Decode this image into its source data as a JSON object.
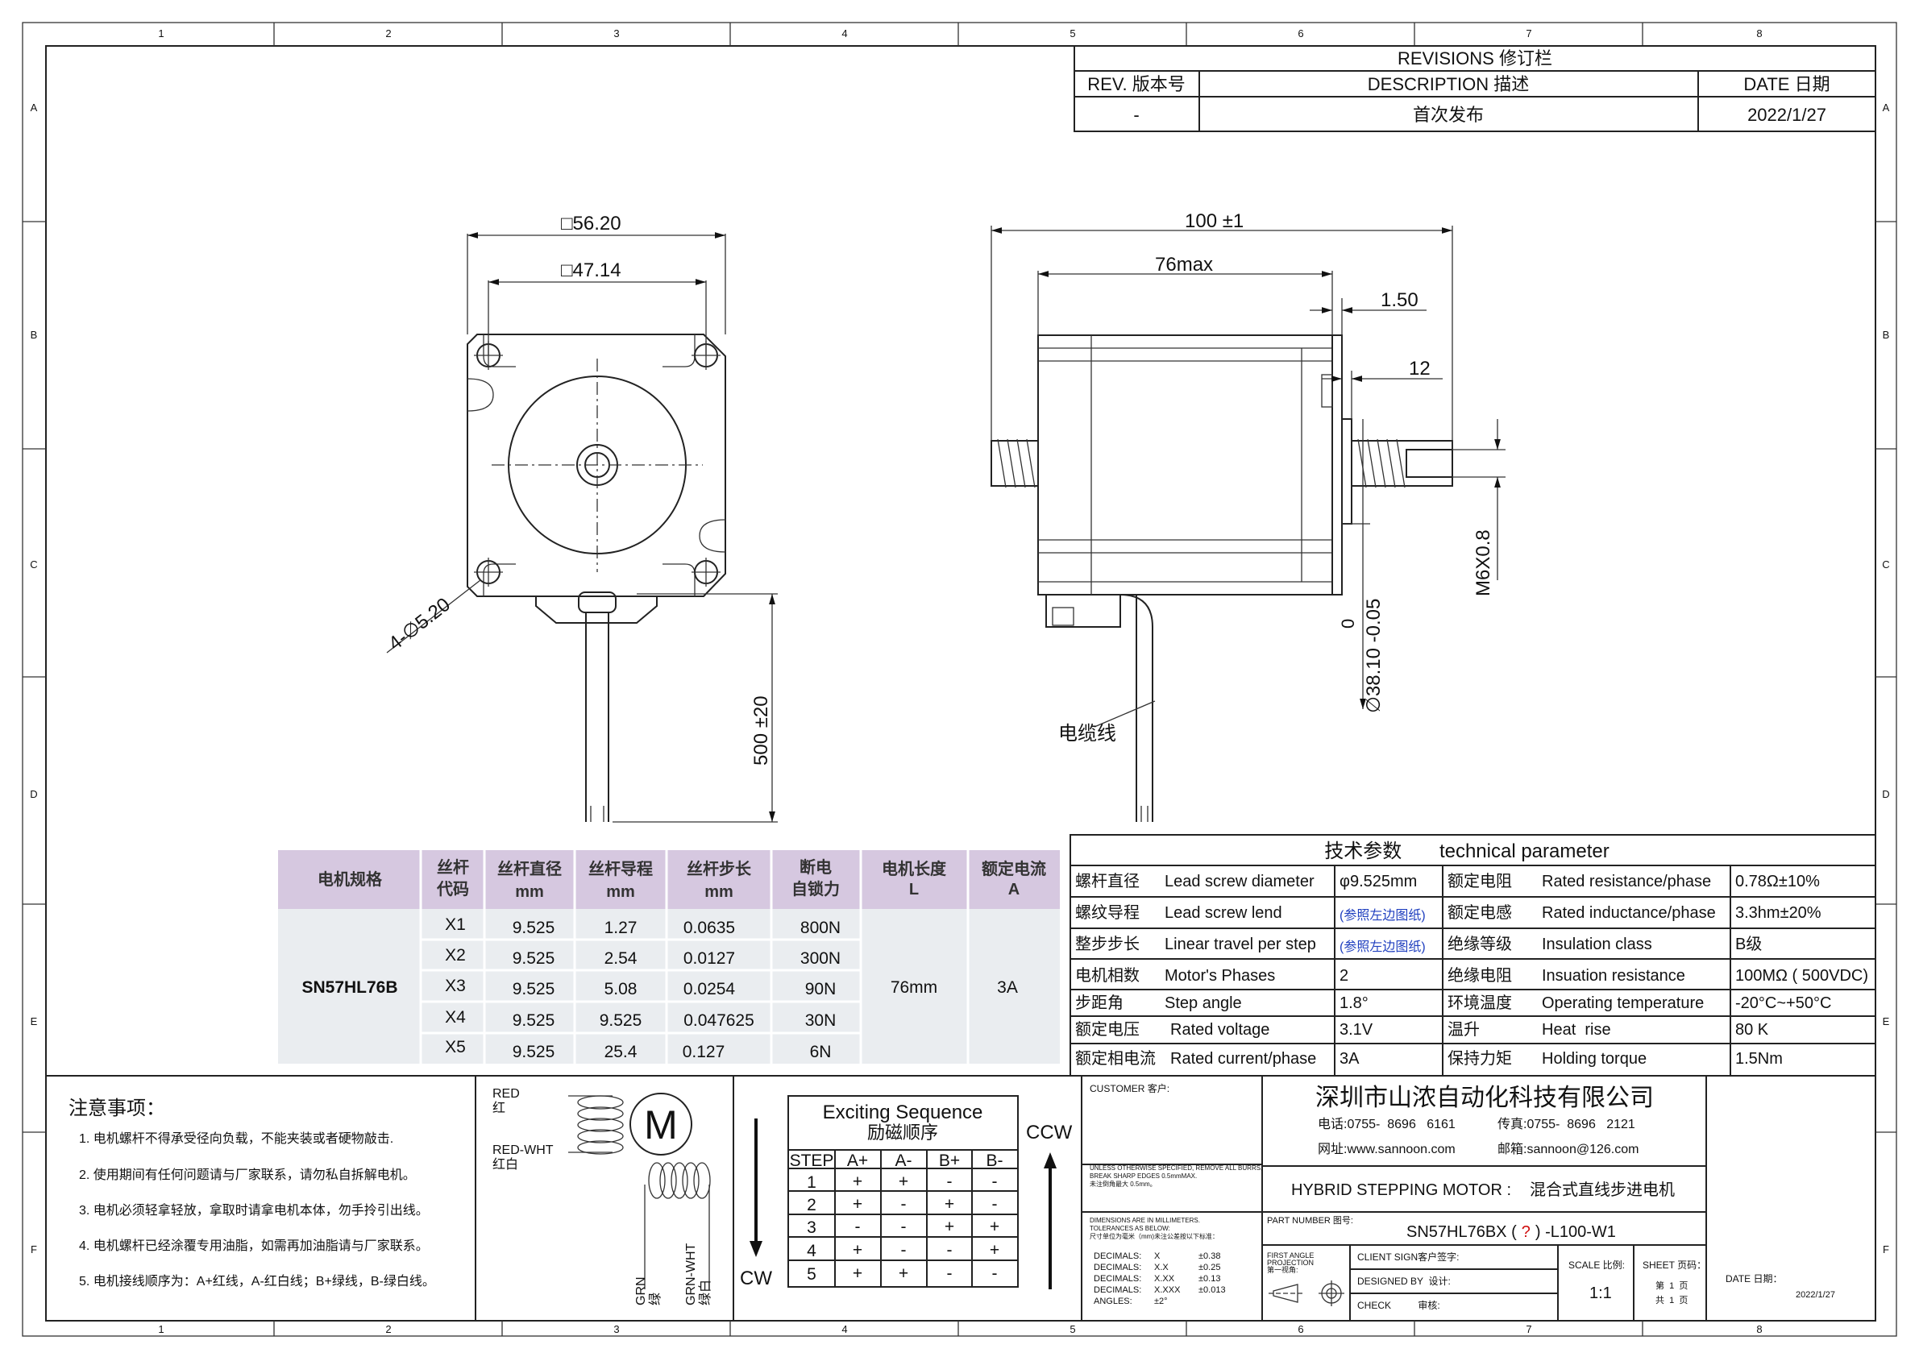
{
  "frame": {
    "cols": [
      "1",
      "2",
      "3",
      "4",
      "5",
      "6",
      "7",
      "8"
    ],
    "rows": [
      "A",
      "B",
      "C",
      "D",
      "E",
      "F"
    ]
  },
  "revisions": {
    "title": "REVISIONS 修订栏",
    "headers": [
      "REV. 版本号",
      "DESCRIPTION 描述",
      "DATE 日期"
    ],
    "row": [
      "-",
      "首次发布",
      "2022/1/27"
    ]
  },
  "front_view": {
    "outer_dim": "□56.20",
    "inner_dim": "□47.14",
    "hole_dim": "4-∅5.20",
    "lead_length": "500 ±20"
  },
  "side_view": {
    "total_length": "100 ±1",
    "body_length": "76max",
    "flange_thickness": "1.50",
    "boss_length": "12",
    "thread": "M6X0.8",
    "boss_diameter": "∅38.10 -0.05",
    "boss_tol_upper": "0",
    "cable_label": "电缆线"
  },
  "spec_table": {
    "headers": [
      [
        "电机规格"
      ],
      [
        "丝杆",
        "代码"
      ],
      [
        "丝杆直径",
        "mm"
      ],
      [
        "丝杆导程",
        "mm"
      ],
      [
        "丝杆步长",
        "mm"
      ],
      [
        "断电",
        "自锁力"
      ],
      [
        "电机长度",
        "L"
      ],
      [
        "额定电流",
        "A"
      ]
    ],
    "model": "SN57HL76B",
    "length": "76mm",
    "current": "3A",
    "rows": [
      [
        "X1",
        "9.525",
        "1.27",
        "0.0635",
        "800N"
      ],
      [
        "X2",
        "9.525",
        "2.54",
        "0.0127",
        "300N"
      ],
      [
        "X3",
        "9.525",
        "5.08",
        "0.0254",
        "90N"
      ],
      [
        "X4",
        "9.525",
        "9.525",
        "0.047625",
        "30N"
      ],
      [
        "X5",
        "9.525",
        "25.4",
        "0.127",
        "6N"
      ]
    ]
  },
  "tech_params": {
    "title": "技术参数       technical parameter",
    "rows": [
      [
        "螺杆直径",
        "Lead screw diameter",
        "φ9.525mm",
        "额定电阻",
        "Rated resistance/phase",
        "0.78Ω±10%"
      ],
      [
        "螺纹导程",
        "Lead screw lend",
        "(参照左边图纸)",
        "额定电感",
        "Rated inductance/phase",
        "3.3hm±20%"
      ],
      [
        "整步步长",
        "Linear travel per step",
        "(参照左边图纸)",
        "绝缘等级",
        "Insulation class",
        "B级"
      ],
      [
        "电机相数",
        "Motor's Phases",
        "2",
        "绝缘电阻",
        "Insuation resistance",
        "100MΩ ( 500VDC)"
      ],
      [
        "步距角",
        "Step angle",
        "1.8°",
        "环境温度",
        "Operating temperature",
        "-20°C~+50°C"
      ],
      [
        "额定电压",
        "Rated voltage",
        "3.1V",
        "温升",
        "Heat  rise",
        "80 K"
      ],
      [
        "额定相电流",
        "Rated current/phase",
        "3A",
        "保持力矩",
        "Holding torque",
        "1.5Nm"
      ]
    ],
    "ref_color": "#1f3fbf"
  },
  "notes": {
    "title": "注意事项：",
    "items": [
      "1. 电机螺杆不得承受径向负载，不能夹装或者硬物敲击.",
      "2. 使用期间有任何问题请与厂家联系，请勿私自拆解电机。",
      "3. 电机必须轻拿轻放，拿取时请拿电机本体，勿手拎引出线。",
      "4. 电机螺杆已经涂覆专用油脂，如需再加油脂请与厂家联系。",
      "5. 电机接线顺序为：A+红线，A-红白线；B+绿线，B-绿白线。"
    ]
  },
  "wiring": {
    "red": "RED",
    "red_cn": "红",
    "red_wht": "RED-WHT",
    "red_wht_cn": "红白",
    "motor": "M",
    "grn": "GRN",
    "grn_cn": "绿",
    "grn_wht": "GRN-WHT",
    "grn_wht_cn": "绿白"
  },
  "sequence": {
    "title": "Exciting Sequence",
    "title_cn": "励磁顺序",
    "headers": [
      "STEP",
      "A+",
      "A-",
      "B+",
      "B-"
    ],
    "rows": [
      [
        "1",
        "+",
        "+",
        "-",
        "-"
      ],
      [
        "2",
        "+",
        "-",
        "+",
        "-"
      ],
      [
        "3",
        "-",
        "-",
        "+",
        "+"
      ],
      [
        "4",
        "+",
        "-",
        "-",
        "+"
      ],
      [
        "5",
        "+",
        "+",
        "-",
        "-"
      ]
    ],
    "ccw": "CCW",
    "cw": "CW"
  },
  "title_block": {
    "customer_label": "CUSTOMER 客户:",
    "unless_1": "UNLESS OTHERWISE SPECIFIED, REMOVE ALL BURRS,",
    "unless_2": "BREAK SHARP EDGES 0.5mmMAX.",
    "unless_3": "未注倒角最大 0.5mm。",
    "dims_1": "DIMENSIONS ARE IN MILLIMETERS.",
    "dims_2": "TOLERANCES AS BELOW:",
    "dims_3": "尺寸单位为毫米（mm)未注公差按以下标准：",
    "tol_rows": [
      [
        "DECIMALS:",
        "X",
        "±0.38"
      ],
      [
        "DECIMALS:",
        "X.X",
        "±0.25"
      ],
      [
        "DECIMALS:",
        "X.XX",
        "±0.13"
      ],
      [
        "DECIMALS:",
        "X.XXX",
        "±0.013"
      ],
      [
        "ANGLES:",
        "±2°",
        ""
      ]
    ],
    "company": "深圳市山浓自动化科技有限公司",
    "phone": "电话:0755-  8696   6161",
    "fax": "传真:0755-  8696   2121",
    "website": "网址:www.sannoon.com",
    "email": "邮箱:sannoon@126.com",
    "product_en": "HYBRID STEPPING MOTOR :",
    "product_cn": "混合式直线步进电机",
    "part_label": "PART NUMBER 图号:",
    "part_prefix": "SN57HL76BX (",
    "part_q": "?",
    "part_suffix": ") -L100-W1",
    "first_angle_1": "FIRST ANGLE",
    "first_angle_2": "PROJECTION",
    "first_angle_3": "第一视角:",
    "client_sign": "CLIENT SIGN客户签字:",
    "designed": "DESIGNED BY  设计:",
    "check": "CHECK          审核:",
    "scale_label": "SCALE 比例:",
    "scale": "1:1",
    "sheet_label": "SHEET 页码：",
    "sheet_1": "第  1  页",
    "sheet_2": "共  1  页",
    "date_label": "DATE 日期：",
    "date": "2022/1/27",
    "company_color": "#1f4fc8",
    "question_color": "#d01010"
  }
}
